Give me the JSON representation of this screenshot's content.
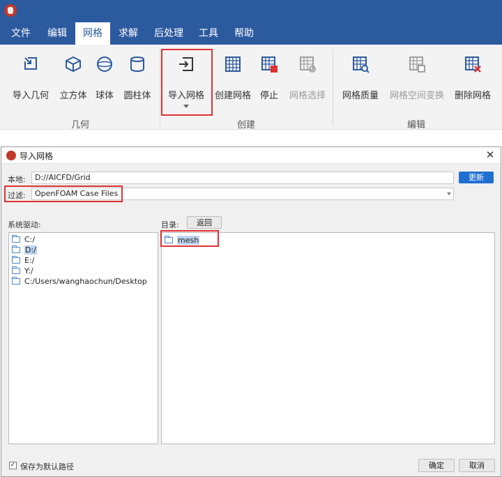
{
  "ribbon": {
    "menu": [
      "文件",
      "编辑",
      "网格",
      "求解",
      "后处理",
      "工具",
      "帮助"
    ],
    "active_menu": "网格",
    "groups": {
      "geometry": {
        "label": "几何",
        "tools": [
          "导入几何",
          "立方体",
          "球体",
          "圆柱体"
        ]
      },
      "create": {
        "label": "创建",
        "tools": [
          "导入网格",
          "创建网格",
          "停止",
          "网格选择"
        ]
      },
      "edit": {
        "label": "编辑",
        "tools": [
          "网格质量",
          "网格空间变换",
          "删除网格"
        ]
      }
    },
    "disabled_tools": [
      "网格选择",
      "网格空间变换"
    ],
    "highlighted_tool": "导入网格",
    "icons": {
      "import_geometry": "import-arrow-icon",
      "cube": "cube-icon",
      "sphere": "sphere-icon",
      "cylinder": "cylinder-icon",
      "import_mesh": "import-mesh-icon",
      "create_mesh": "grid-icon",
      "stop": "grid-stop-icon",
      "mesh_select": "grid-select-icon",
      "mesh_quality": "grid-quality-icon",
      "mesh_transform": "grid-transform-icon",
      "delete_mesh": "grid-delete-icon"
    }
  },
  "dialog": {
    "title": "导入网格",
    "local_label": "本地:",
    "local_value": "D://AICFD/Grid",
    "update_button": "更新",
    "filter_label": "过滤:",
    "filter_value": "OpenFOAM Case Files",
    "drives_label": "系统驱动:",
    "drives": [
      "C:/",
      "D:/",
      "E:/",
      "Y:/",
      "C:/Users/wanghaochun/Desktop"
    ],
    "selected_drive": "D:/",
    "dir_label": "目录:",
    "back_button": "返回",
    "entries": [
      "mesh"
    ],
    "save_default_label": "保存为默认路径",
    "save_default_checked": true,
    "ok_button": "确定",
    "cancel_button": "取消"
  },
  "colors": {
    "accent": "#2c5a9f",
    "highlight_red": "#e03131",
    "button_blue": "#1f6fd1",
    "selection": "#bcd4f0"
  }
}
